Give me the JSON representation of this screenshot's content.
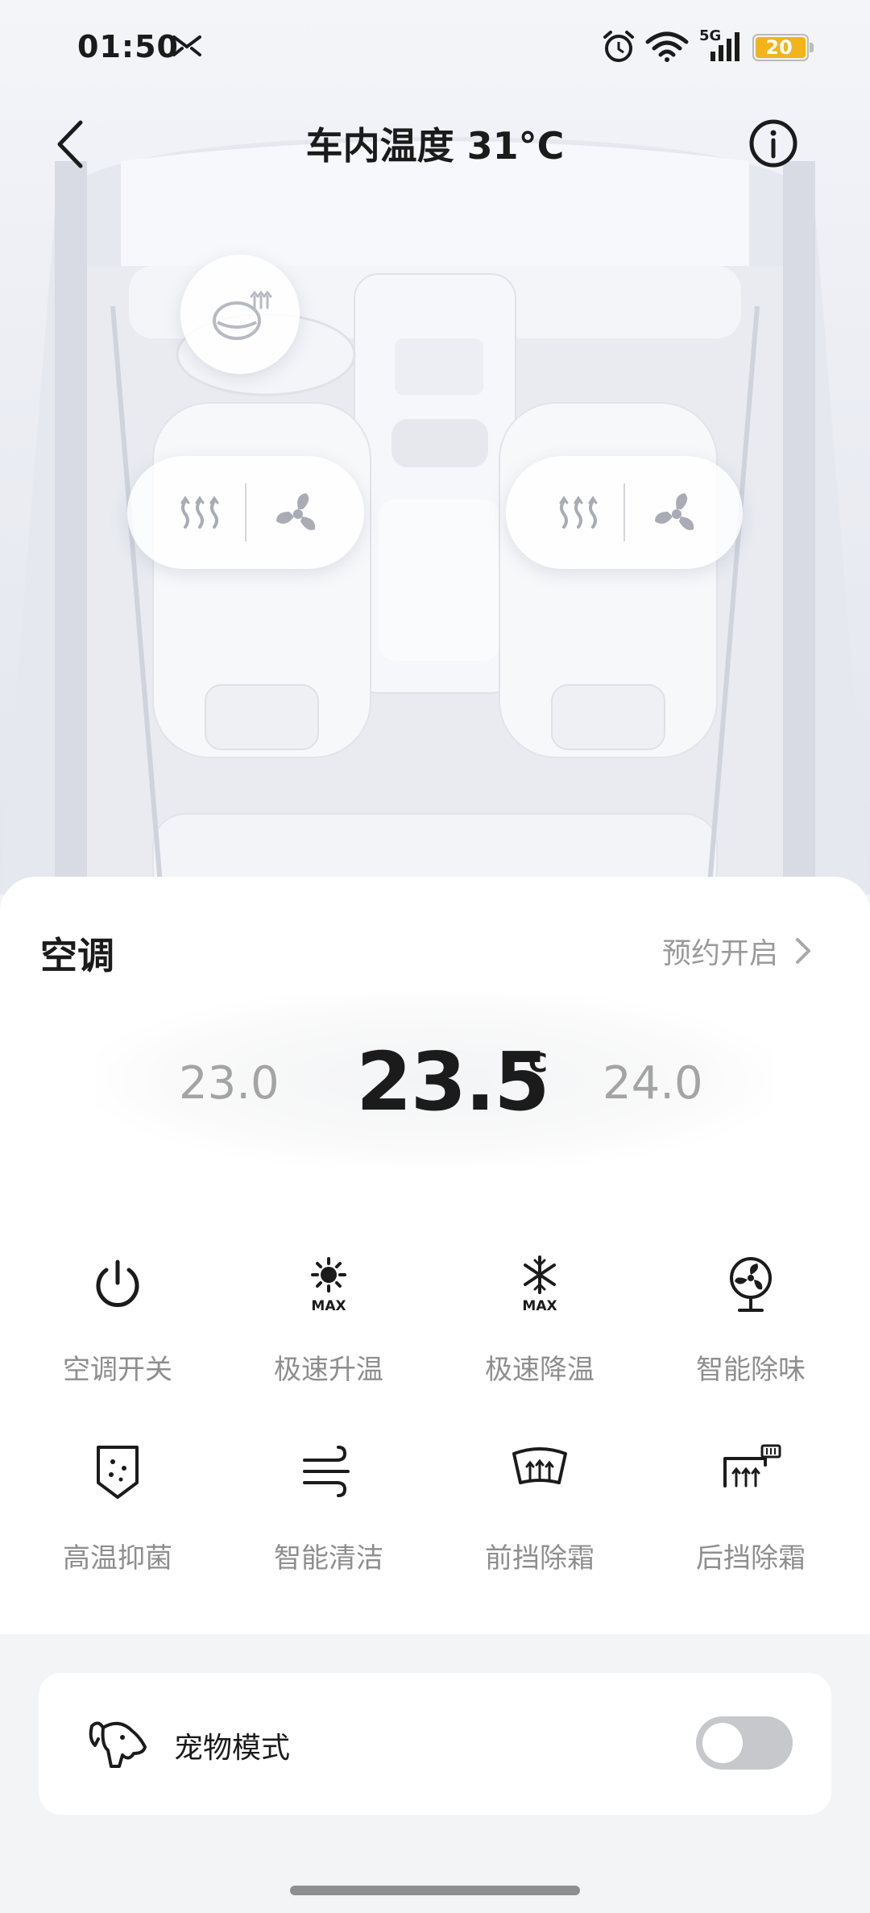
{
  "status_bar": {
    "time": "01:50",
    "network_label": "5G",
    "battery": "20",
    "battery_level": 0.2
  },
  "nav": {
    "title": "车内温度 31°C"
  },
  "panel": {
    "title": "空调",
    "schedule_label": "预约开启",
    "temperature": {
      "lower": "23.0",
      "current": "23.5",
      "unit": "°C",
      "higher": "24.0"
    },
    "functions": [
      {
        "label": "空调开关",
        "icon": "power-icon"
      },
      {
        "label": "极速升温",
        "icon": "sun-max-icon"
      },
      {
        "label": "极速降温",
        "icon": "snowflake-max-icon"
      },
      {
        "label": "智能除味",
        "icon": "fan-deodorize-icon"
      },
      {
        "label": "高温抑菌",
        "icon": "shield-sterilize-icon"
      },
      {
        "label": "智能清洁",
        "icon": "wind-clean-icon"
      },
      {
        "label": "前挡除霜",
        "icon": "front-defrost-icon"
      },
      {
        "label": "后挡除霜",
        "icon": "rear-defrost-icon"
      }
    ],
    "icon_max_text": "MAX"
  },
  "pet_mode": {
    "label": "宠物模式",
    "enabled": false
  },
  "colors": {
    "accent_battery": "#f3b31b",
    "text_primary": "#1b1b1b",
    "text_secondary": "#8e8e8e",
    "toggle_off": "#c7c8cc"
  }
}
